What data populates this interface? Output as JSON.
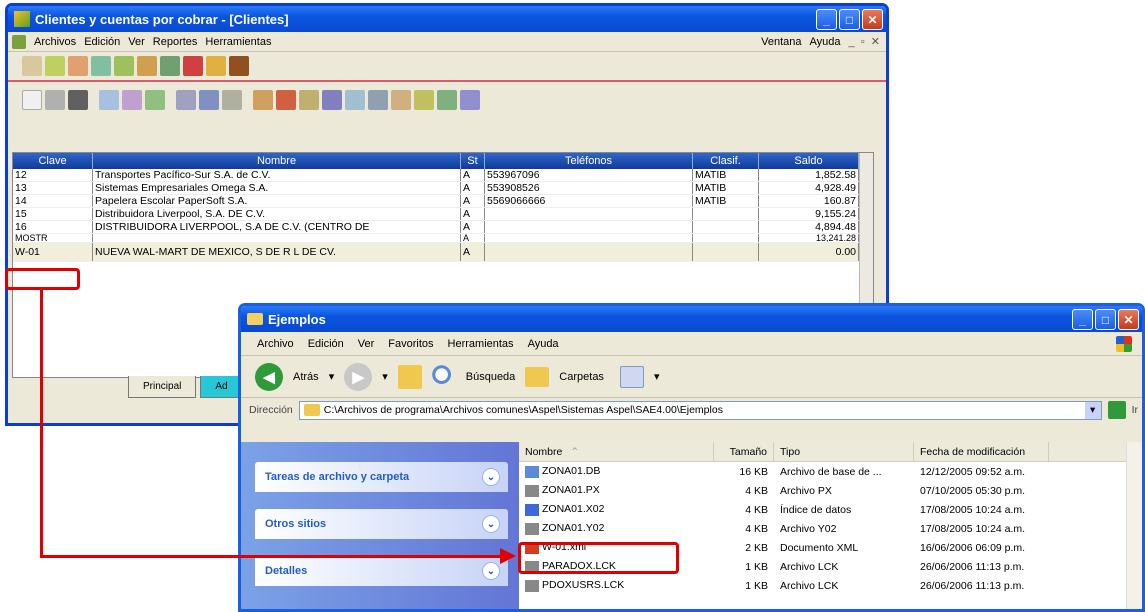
{
  "win1": {
    "title": "Clientes y cuentas por cobrar - [Clientes]",
    "menu": [
      "Archivos",
      "Edición",
      "Ver",
      "Reportes",
      "Herramientas"
    ],
    "menu_right": [
      "Ventana",
      "Ayuda"
    ],
    "columns": [
      "Clave",
      "Nombre",
      "St",
      "Teléfonos",
      "Clasif.",
      "Saldo"
    ],
    "rows": [
      {
        "clave": "12",
        "nombre": "Transportes Pacífico-Sur S.A. de C.V.",
        "st": "A",
        "tel": "553967096",
        "clasif": "MATIB",
        "saldo": "1,852.58"
      },
      {
        "clave": "13",
        "nombre": "Sistemas Empresariales Omega S.A.",
        "st": "A",
        "tel": "553908526",
        "clasif": "MATIB",
        "saldo": "4,928.49"
      },
      {
        "clave": "14",
        "nombre": "Papelera Escolar PaperSoft S.A.",
        "st": "A",
        "tel": "5569066666",
        "clasif": "MATIB",
        "saldo": "160.87"
      },
      {
        "clave": "15",
        "nombre": "Distribuidora Liverpool, S.A. DE C.V.",
        "st": "A",
        "tel": "",
        "clasif": "",
        "saldo": "9,155.24"
      },
      {
        "clave": "16",
        "nombre": "DISTRIBUIDORA LIVERPOOL, S.A DE C.V. (CENTRO DE",
        "st": "A",
        "tel": "",
        "clasif": "",
        "saldo": "4,894.48"
      },
      {
        "clave": "MOSTR",
        "nombre": "",
        "st": "A",
        "tel": "",
        "clasif": "",
        "saldo": "13,241.28"
      },
      {
        "clave": "W-01",
        "nombre": "NUEVA WAL-MART DE MEXICO, S DE R L DE CV.",
        "st": "A",
        "tel": "",
        "clasif": "",
        "saldo": "0.00"
      }
    ],
    "tabs": [
      "Principal",
      "Ad"
    ]
  },
  "win2": {
    "title": "Ejemplos",
    "menu": [
      "Archivo",
      "Edición",
      "Ver",
      "Favoritos",
      "Herramientas",
      "Ayuda"
    ],
    "back_label": "Atrás",
    "search_label": "Búsqueda",
    "folders_label": "Carpetas",
    "address_label": "Dirección",
    "address": "C:\\Archivos de programa\\Archivos comunes\\Aspel\\Sistemas Aspel\\SAE4.00\\Ejemplos",
    "go_label": "Ir",
    "panels": [
      "Tareas de archivo y carpeta",
      "Otros sitios",
      "Detalles"
    ],
    "columns": [
      "Nombre",
      "Tamaño",
      "Tipo",
      "Fecha de modificación"
    ],
    "files": [
      {
        "name": "ZONA01.DB",
        "size": "16 KB",
        "type": "Archivo de base de ...",
        "date": "12/12/2005 09:52 a.m.",
        "color": "#5a8ad8"
      },
      {
        "name": "ZONA01.PX",
        "size": "4 KB",
        "type": "Archivo PX",
        "date": "07/10/2005 05:30 p.m.",
        "color": "#888888"
      },
      {
        "name": "ZONA01.X02",
        "size": "4 KB",
        "type": "Índice de datos",
        "date": "17/08/2005 10:24 a.m.",
        "color": "#3a6ad8"
      },
      {
        "name": "ZONA01.Y02",
        "size": "4 KB",
        "type": "Archivo Y02",
        "date": "17/08/2005 10:24 a.m.",
        "color": "#888888"
      },
      {
        "name": "W-01.xml",
        "size": "2 KB",
        "type": "Documento XML",
        "date": "16/06/2006 06:09 p.m.",
        "color": "#d04020"
      },
      {
        "name": "PARADOX.LCK",
        "size": "1 KB",
        "type": "Archivo LCK",
        "date": "26/06/2006 11:13 p.m.",
        "color": "#888888"
      },
      {
        "name": "PDOXUSRS.LCK",
        "size": "1 KB",
        "type": "Archivo LCK",
        "date": "26/06/2006 11:13 p.m.",
        "color": "#888888"
      }
    ]
  },
  "colors": {
    "annotation": "#e00000",
    "xp_blue": "#0a4ad0"
  }
}
